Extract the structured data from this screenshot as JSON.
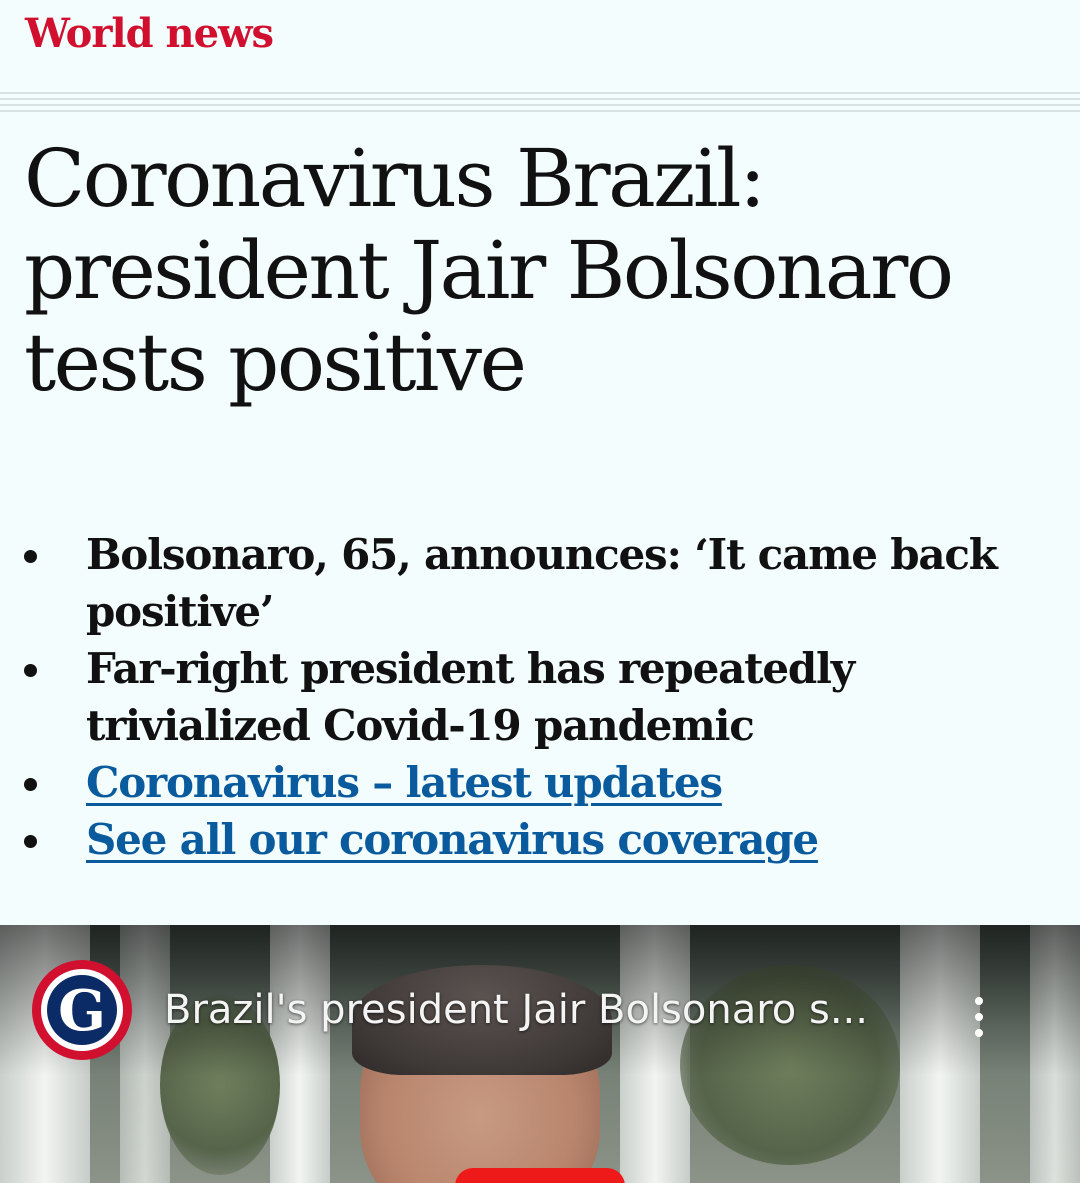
{
  "section": {
    "label": "World news",
    "color": "#d0102e"
  },
  "article": {
    "headline": "Coronavirus Brazil: president Jair Bolsonaro tests positive",
    "standfirst": [
      {
        "text": "Bolsonaro, 65, announces: ‘It came back positive’",
        "link": false
      },
      {
        "text": "Far-right president has repeatedly trivialized Covid-19 pandemic",
        "link": false
      },
      {
        "text": "Coronavirus – latest updates",
        "link": true
      },
      {
        "text": "See all our coronavirus coverage",
        "link": true
      }
    ],
    "link_color": "#0a5a9e"
  },
  "video": {
    "channel_logo_letter": "G",
    "title": "Brazil's president Jair Bolsonaro s...",
    "more_icon": "more-vertical-icon",
    "play_icon": "play-button-icon",
    "play_color": "#ee1a1a"
  }
}
